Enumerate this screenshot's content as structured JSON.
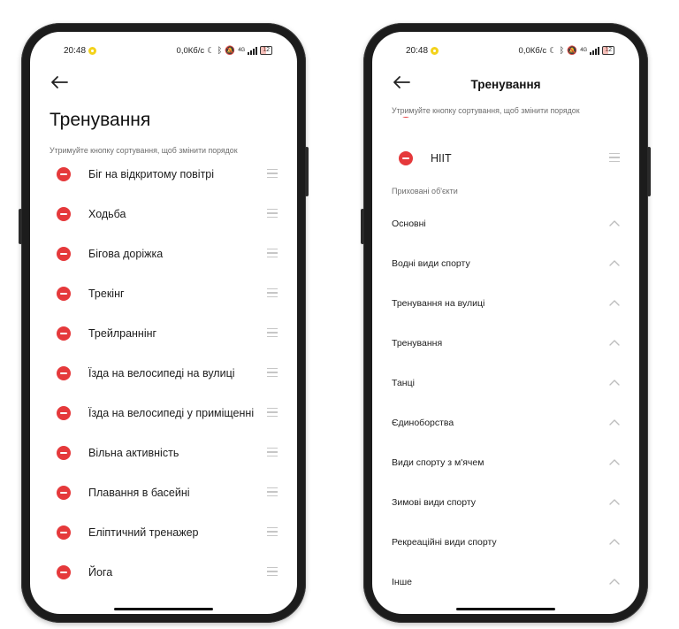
{
  "status_bar": {
    "time": "20:48",
    "speed": "0,0Кб/с",
    "network": "4G",
    "battery": "12"
  },
  "left_screen": {
    "title": "Тренування",
    "hint": "Утримуйте кнопку сортування, щоб змінити порядок",
    "items": [
      "Біг на відкритому повітрі",
      "Ходьба",
      "Бігова доріжка",
      "Трекінг",
      "Трейлраннінг",
      "Їзда на велосипеді на вулиці",
      "Їзда на велосипеді у приміщенні",
      "Вільна активність",
      "Плавання в басейні",
      "Еліптичний тренажер",
      "Йога"
    ]
  },
  "right_screen": {
    "title": "Тренування",
    "hint": "Утримуйте кнопку сортування, щоб змінити порядок",
    "partial_item": "HIIT",
    "hidden_label": "Приховані об'єкти",
    "categories": [
      "Основні",
      "Водні види спорту",
      "Тренування на вулиці",
      "Тренування",
      "Танці",
      "Єдиноборства",
      "Види спорту з м'ячем",
      "Зимові види спорту",
      "Рекреаційні види спорту",
      "Інше"
    ]
  }
}
